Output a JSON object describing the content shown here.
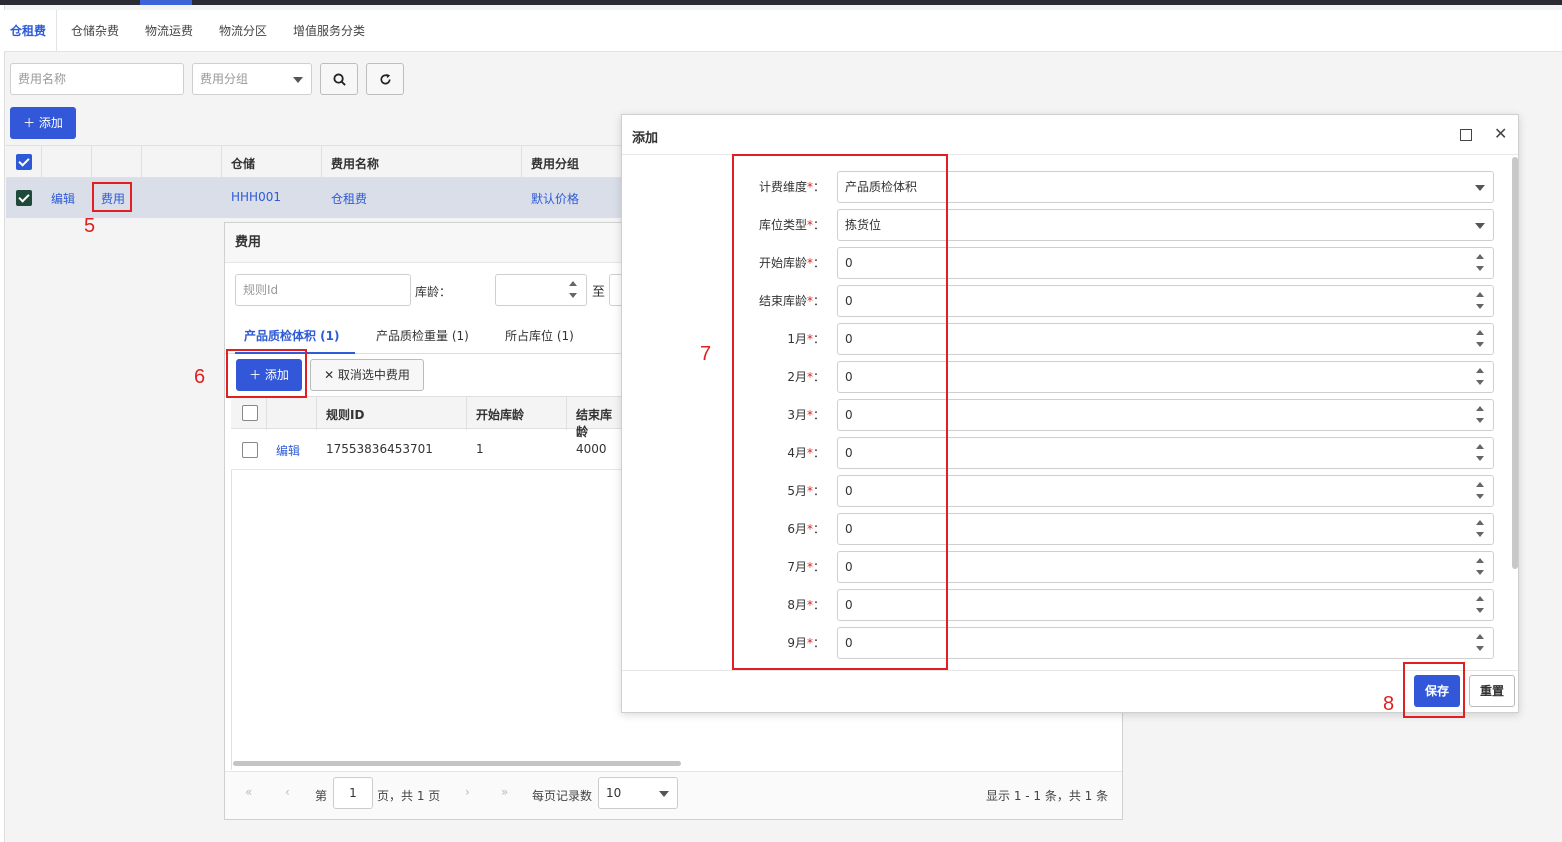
{
  "tabs": [
    "仓租费",
    "仓储杂费",
    "物流运费",
    "物流分区",
    "增值服务分类"
  ],
  "search": {
    "name_placeholder": "费用名称",
    "group_placeholder": "费用分组"
  },
  "toolbar": {
    "add_label": "＋ 添加"
  },
  "grid": {
    "headers": [
      "仓储",
      "费用名称",
      "费用分组"
    ],
    "row": {
      "edit": "编辑",
      "fee": "费用",
      "warehouse": "HHH001",
      "fee_name": "仓租费",
      "group": "默认价格"
    }
  },
  "fee_panel": {
    "title": "费用",
    "rule_placeholder": "规则Id",
    "age_label": "库龄：",
    "to_label": "至",
    "tabs": [
      "产品质检体积 (1)",
      "产品质检重量 (1)",
      "所占库位 (1)"
    ],
    "add_label": "＋ 添加",
    "cancel_label": "✕ 取消选中费用",
    "headers": [
      "规则ID",
      "开始库龄",
      "结束库龄"
    ],
    "row": {
      "edit": "编辑",
      "rule_id": "17553836453701",
      "start_age": "1",
      "end_age": "4000"
    },
    "pager": {
      "page_prefix": "第",
      "page": "1",
      "page_suffix": "页，共 1 页",
      "per_page_label": "每页记录数",
      "per_page": "10",
      "summary": "显示 1 - 1 条，共 1 条"
    }
  },
  "modal": {
    "title": "添加",
    "fields": [
      {
        "label": "计费维度",
        "value": "产品质检体积",
        "type": "select"
      },
      {
        "label": "库位类型",
        "value": "拣货位",
        "type": "select"
      },
      {
        "label": "开始库龄",
        "value": "0",
        "type": "number"
      },
      {
        "label": "结束库龄",
        "value": "0",
        "type": "number"
      },
      {
        "label": "1月",
        "value": "0",
        "type": "number"
      },
      {
        "label": "2月",
        "value": "0",
        "type": "number"
      },
      {
        "label": "3月",
        "value": "0",
        "type": "number"
      },
      {
        "label": "4月",
        "value": "0",
        "type": "number"
      },
      {
        "label": "5月",
        "value": "0",
        "type": "number"
      },
      {
        "label": "6月",
        "value": "0",
        "type": "number"
      },
      {
        "label": "7月",
        "value": "0",
        "type": "number"
      },
      {
        "label": "8月",
        "value": "0",
        "type": "number"
      },
      {
        "label": "9月",
        "value": "0",
        "type": "number"
      }
    ],
    "save_label": "保存",
    "reset_label": "重置"
  },
  "annotations": [
    "5",
    "6",
    "7",
    "8"
  ],
  "colors": {
    "accent": "#3257d8",
    "annotation": "#e02020"
  }
}
